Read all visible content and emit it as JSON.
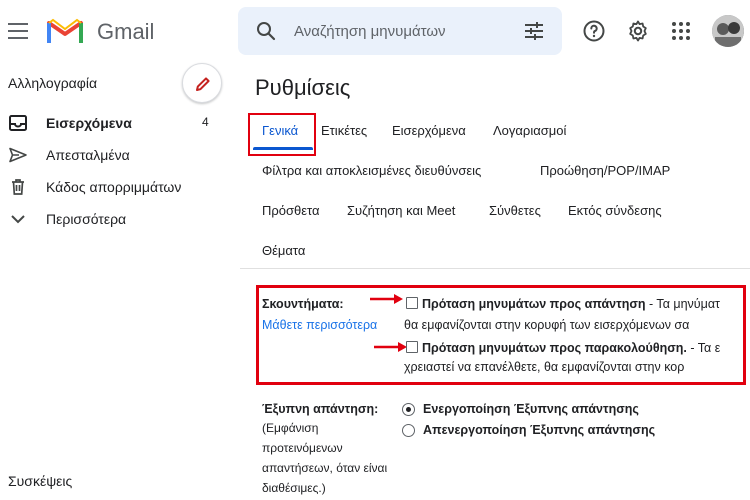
{
  "header": {
    "app_name": "Gmail",
    "search_placeholder": "Αναζήτηση μηνυμάτων"
  },
  "sidebar": {
    "mail_label": "Αλληλογραφία",
    "items": [
      {
        "label": "Εισερχόμενα",
        "count": "4",
        "icon": "inbox-icon",
        "active": true
      },
      {
        "label": "Απεσταλμένα",
        "icon": "send-icon"
      },
      {
        "label": "Κάδος απορριμμάτων",
        "icon": "trash-icon"
      },
      {
        "label": "Περισσότερα",
        "icon": "chevron-down-icon"
      }
    ],
    "meet_label": "Συσκέψεις"
  },
  "main": {
    "title": "Ρυθμίσεις",
    "tabs": [
      "Γενικά",
      "Ετικέτες",
      "Εισερχόμενα",
      "Λογαριασμοί",
      "Φίλτρα και αποκλεισμένες διευθύνσεις",
      "Προώθηση/POP/IMAP",
      "Πρόσθετα",
      "Συζήτηση και Meet",
      "Σύνθετες",
      "Εκτός σύνδεσης",
      "Θέματα"
    ],
    "nudges": {
      "label": "Σκουντήματα:",
      "learn_more": "Μάθετε περισσότερα",
      "option1_bold": "Πρόταση μηνυμάτων προς απάντηση",
      "option1_rest": " - Τα μηνύματ",
      "option1_line2": "θα εμφανίζονται στην κορυφή των εισερχόμενων σα",
      "option2_bold": "Πρόταση μηνυμάτων προς παρακολούθηση.",
      "option2_rest": " - Τα ε",
      "option2_line2": "χρειαστεί να επανέλθετε, θα εμφανίζονται στην κορ"
    },
    "smart_reply": {
      "label": "Έξυπνη απάντηση:",
      "note_lines": [
        "(Εμφάνιση",
        "προτεινόμενων",
        "απαντήσεων, όταν είναι",
        "διαθέσιμες.)"
      ],
      "on_label": "Ενεργοποίηση Έξυπνης απάντησης",
      "off_label": "Απενεργοποίηση Έξυπνης απάντησης"
    }
  },
  "colors": {
    "accent": "#0b57d0",
    "highlight": "#e1000f",
    "link": "#1a73e8"
  }
}
